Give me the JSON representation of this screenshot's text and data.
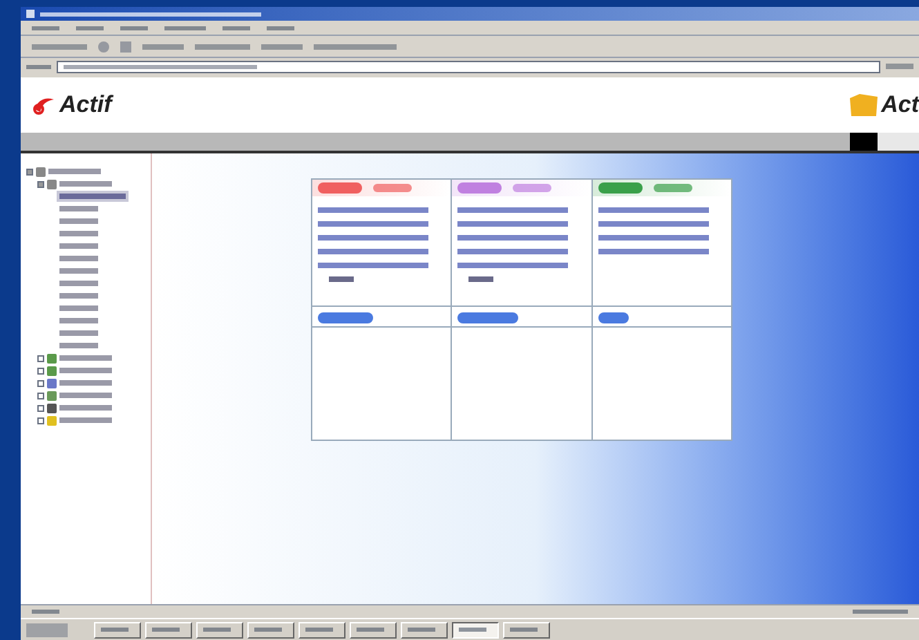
{
  "logo": {
    "text": "Actif"
  },
  "logo_right": {
    "text": "Act"
  },
  "tree": [
    {
      "kind": "folder",
      "expanded": true,
      "children": [
        {
          "kind": "folder",
          "expanded": true,
          "children": [
            {
              "kind": "leaf",
              "selected": true
            },
            {
              "kind": "leaf",
              "selected": false
            },
            {
              "kind": "leaf",
              "selected": false
            },
            {
              "kind": "leaf",
              "selected": false
            },
            {
              "kind": "leaf",
              "selected": false
            },
            {
              "kind": "leaf",
              "selected": false
            },
            {
              "kind": "leaf",
              "selected": false
            },
            {
              "kind": "leaf",
              "selected": false
            },
            {
              "kind": "leaf",
              "selected": false
            },
            {
              "kind": "leaf",
              "selected": false
            },
            {
              "kind": "leaf",
              "selected": false
            },
            {
              "kind": "leaf",
              "selected": false
            },
            {
              "kind": "leaf",
              "selected": false
            }
          ]
        },
        {
          "kind": "folder",
          "expanded": false,
          "color": "#5a9a4a"
        },
        {
          "kind": "folder",
          "expanded": false,
          "color": "#5a9a4a"
        },
        {
          "kind": "folder",
          "expanded": false,
          "color": "#6a78c8"
        },
        {
          "kind": "folder",
          "expanded": false,
          "color": "#6a9a5a"
        },
        {
          "kind": "folder",
          "expanded": false,
          "color": "#555555"
        },
        {
          "kind": "folder",
          "expanded": false,
          "color": "#e0c020"
        }
      ]
    }
  ],
  "panels": [
    {
      "color": "#f06060",
      "items": [
        {
          "kind": "line"
        },
        {
          "kind": "line"
        },
        {
          "kind": "line"
        },
        {
          "kind": "line"
        },
        {
          "kind": "line"
        }
      ],
      "more": true
    },
    {
      "color": "#c080e0",
      "items": [
        {
          "kind": "line"
        },
        {
          "kind": "line"
        },
        {
          "kind": "line"
        },
        {
          "kind": "line"
        },
        {
          "kind": "line"
        }
      ],
      "more": true
    },
    {
      "color": "#3aa04a",
      "items": [
        {
          "kind": "line"
        },
        {
          "kind": "line"
        },
        {
          "kind": "line"
        },
        {
          "kind": "line"
        }
      ],
      "more": false
    }
  ],
  "taskbar": [
    {
      "selected": false
    },
    {
      "selected": false
    },
    {
      "selected": false
    },
    {
      "selected": false
    },
    {
      "selected": false
    },
    {
      "selected": false
    },
    {
      "selected": false
    },
    {
      "selected": true
    },
    {
      "selected": false
    }
  ]
}
